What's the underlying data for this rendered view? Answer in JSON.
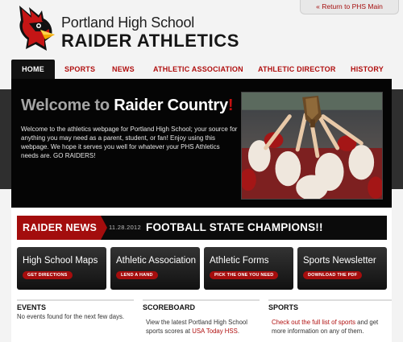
{
  "header": {
    "return_link": "« Return to PHS Main",
    "school_name": "Portland High School",
    "department": "RAIDER ATHLETICS"
  },
  "nav": {
    "items": [
      {
        "label": "HOME",
        "active": true
      },
      {
        "label": "SPORTS",
        "active": false
      },
      {
        "label": "NEWS",
        "active": false
      },
      {
        "label": "ATHLETIC ASSOCIATION",
        "active": false
      },
      {
        "label": "ATHLETIC DIRECTOR",
        "active": false
      },
      {
        "label": "HISTORY",
        "active": false
      }
    ]
  },
  "hero": {
    "title_welcome": "Welcome to ",
    "title_main": "Raider Country",
    "title_bang": "!",
    "text": "Welcome to the athletics webpage for Portland High School; your source for anything you may need as a parent, student, or fan! Enjoy using this webpage. We hope it serves you well for whatever your PHS Athletics needs are. GO RAIDERS!"
  },
  "news": {
    "label": "RAIDER NEWS",
    "date": "11.28.2012",
    "headline": "FOOTBALL STATE CHAMPIONS!!"
  },
  "features": [
    {
      "title": "High School Maps",
      "button": "GET DIRECTIONS"
    },
    {
      "title": "Athletic Association",
      "button": "LEND A HAND"
    },
    {
      "title": "Athletic Forms",
      "button": "PICK THE ONE YOU NEED"
    },
    {
      "title": "Sports Newsletter",
      "button": "DOWNLOAD THE PDF"
    }
  ],
  "columns": {
    "events": {
      "title": "EVENTS",
      "text": "No events found for the next few days."
    },
    "scoreboard": {
      "title": "SCOREBOARD",
      "text_pre": "View the latest Portland High School sports scores at ",
      "link": "USA Today HSS",
      "text_post": "."
    },
    "sports": {
      "title": "SPORTS",
      "link": "Check out the full list of sports",
      "text_post": " and get more information on any of them."
    }
  },
  "colors": {
    "accent": "#a30d0d",
    "dark": "#0b0b0b"
  }
}
